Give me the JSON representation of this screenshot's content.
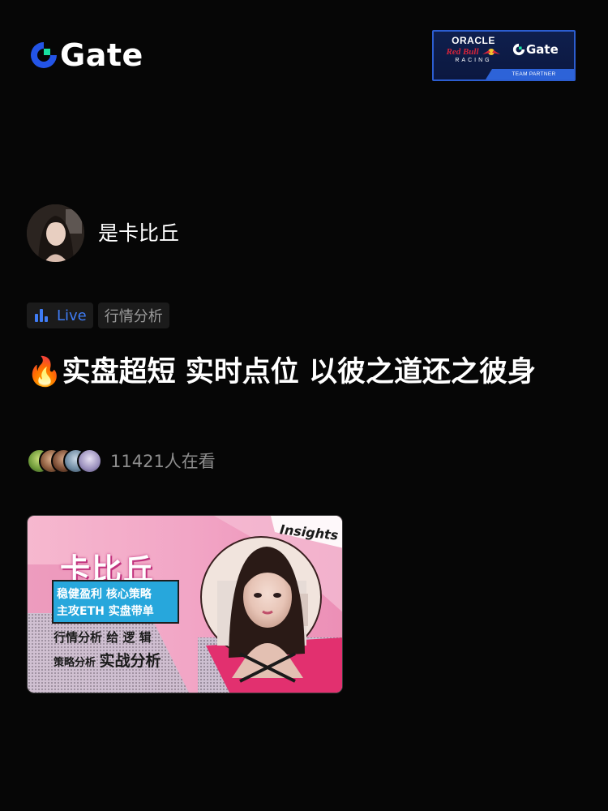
{
  "brand": {
    "name": "Gate",
    "colors": {
      "accent_blue": "#2354e6",
      "accent_green": "#17e0a0"
    }
  },
  "partner_badge": {
    "oracle": "ORACLE",
    "red_bull": "Red Bull",
    "racing": "RACING",
    "gate": "Gate",
    "caption": "TEAM PARTNER"
  },
  "streamer": {
    "name": "是卡比丘"
  },
  "tags": {
    "live": "Live",
    "category": "行情分析"
  },
  "stream": {
    "title_emoji": "🔥",
    "title": "实盘超短 实时点位 以彼之道还之彼身"
  },
  "viewers": {
    "count_text": "11421人在看"
  },
  "cover": {
    "name": "卡比丘",
    "line1": "稳健盈利  核心策略",
    "line2": "主攻ETH  实盘带单",
    "line3": "行情分析 给 逻 辑",
    "line4_small": "策略分析 ",
    "line4_big": "实战分析",
    "sticker": "Insights"
  }
}
